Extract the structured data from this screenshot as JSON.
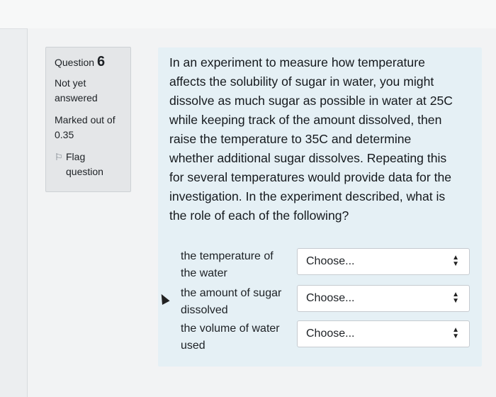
{
  "info": {
    "question_word": "Question",
    "question_number": "6",
    "state_line1": "Not yet",
    "state_line2": "answered",
    "grade_line1": "Marked out of",
    "grade_line2": "0.35",
    "flag_line1": "Flag",
    "flag_line2": "question"
  },
  "question": {
    "line1": "In an experiment to measure how temperature",
    "line2": "affects the solubility of sugar in water, you might",
    "line3": "dissolve as much sugar as possible in water at 25C",
    "line4": "while keeping track of the amount dissolved, then",
    "line5": "raise the temperature to 35C and determine",
    "line6": "whether additional sugar dissolves. Repeating this",
    "line7": "for several temperatures would provide data for the",
    "line8": "investigation. In the experiment described, what is",
    "line9": "the role of each of the following?"
  },
  "matches": [
    {
      "label1": "the temperature of",
      "label2": "the water",
      "choice": "Choose..."
    },
    {
      "label1": "the amount of sugar",
      "label2": "dissolved",
      "choice": "Choose..."
    },
    {
      "label1": "the volume of water",
      "label2": "used",
      "choice": "Choose..."
    }
  ],
  "icons": {
    "flag": "flag-icon",
    "select_arrows": "updown-arrows-icon",
    "cursor": "mouse-cursor-icon"
  }
}
